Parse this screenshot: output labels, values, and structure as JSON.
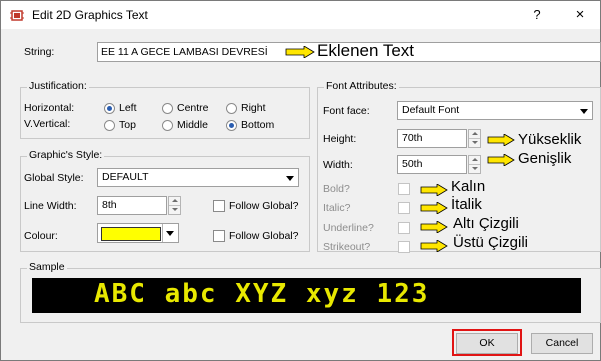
{
  "window": {
    "title": "Edit 2D Graphics Text",
    "help": "?",
    "close": "×"
  },
  "string_field": {
    "label": "String:",
    "value": "EE 11 A GECE LAMBASI DEVRESİ"
  },
  "justification": {
    "legend": "Justification:",
    "horizontal_label": "Horizontal:",
    "vertical_label": "V.Vertical:",
    "horizontal_options": [
      "Left",
      "Centre",
      "Right"
    ],
    "horizontal_selected": "Left",
    "vertical_options": [
      "Top",
      "Middle",
      "Bottom"
    ],
    "vertical_selected": "Bottom"
  },
  "graphics_style": {
    "legend": "Graphic's Style:",
    "global_style_label": "Global Style:",
    "global_style_value": "DEFAULT",
    "line_width_label": "Line Width:",
    "line_width_value": "8th",
    "colour_label": "Colour:",
    "colour_value": "#ffff00",
    "follow_global_1": "Follow Global?",
    "follow_global_2": "Follow Global?"
  },
  "font_attributes": {
    "legend": "Font Attributes:",
    "font_face_label": "Font face:",
    "font_face_value": "Default Font",
    "height_label": "Height:",
    "height_value": "70th",
    "width_label": "Width:",
    "width_value": "50th",
    "bold_label": "Bold?",
    "italic_label": "Italic?",
    "underline_label": "Underline?",
    "strikeout_label": "Strikeout?"
  },
  "sample": {
    "legend": "Sample",
    "text": "ABC abc XYZ xyz 123",
    "text_color": "#e8e800",
    "background_color": "#000000"
  },
  "buttons": {
    "ok": "OK",
    "cancel": "Cancel"
  },
  "annotations": {
    "string": "Eklenen Text",
    "height": "Yükseklik",
    "width": "Genişlik",
    "bold": "Kalın",
    "italic": "İtalik",
    "underline": "Altı Çizgili",
    "strikeout": "Üstü Çizgili",
    "arrow_color": "#ffe600",
    "highlight_color": "#e11414"
  }
}
